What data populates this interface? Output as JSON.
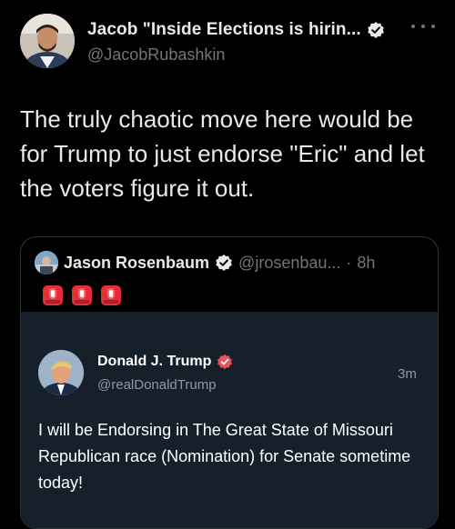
{
  "tweet": {
    "author": {
      "display_name": "Jacob \"Inside Elections is hirin...",
      "handle": "@JacobRubashkin",
      "verified_icon": "verified-badge-icon",
      "avatar_icon": "user-avatar"
    },
    "more_icon": "more-horizontal-icon",
    "text": "The truly chaotic move here would be for Trump to just endorse \"Eric\" and let the voters figure it out."
  },
  "quote": {
    "author": {
      "display_name": "Jason Rosenbaum",
      "handle": "@jrosenbau...",
      "separator": "·",
      "time": "8h",
      "verified_icon": "verified-badge-icon"
    },
    "emoji": [
      "police-car-light",
      "police-car-light",
      "police-car-light"
    ],
    "embedded": {
      "display_name": "Donald J. Trump",
      "handle": "@realDonaldTrump",
      "time": "3m",
      "badge_icon": "red-verified-badge-icon",
      "text": "I will be Endorsing in The Great State of Missouri Republican race (Nomination) for Senate sometime today!"
    }
  },
  "colors": {
    "background": "#000000",
    "primary_text": "#e7e9ea",
    "secondary_text": "#71767b",
    "card_border": "#2f3336",
    "embedded_background": "#15202b",
    "verified_blue": "#1d9bf0",
    "siren_red": "#e0303a"
  }
}
